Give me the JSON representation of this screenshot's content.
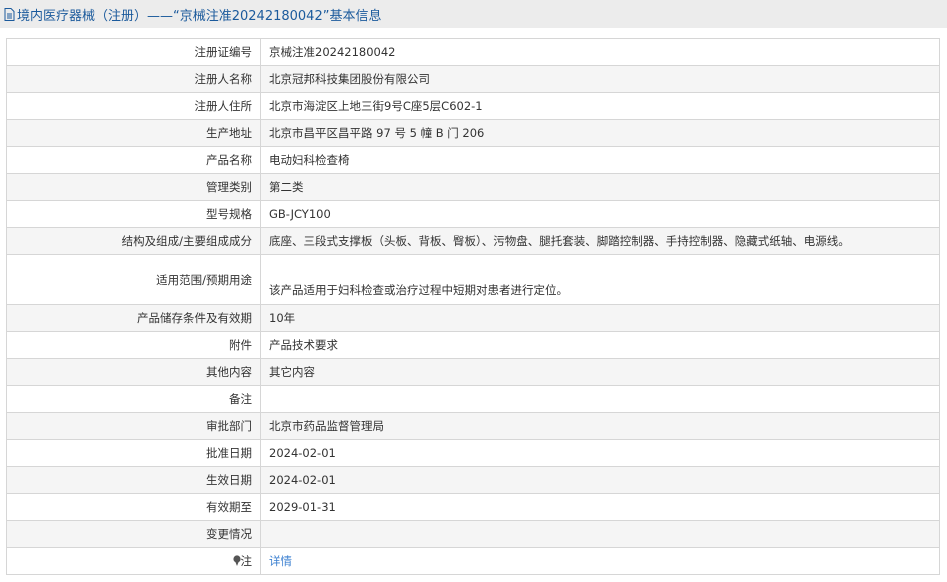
{
  "header": {
    "title": "境内医疗器械（注册）——“京械注准20242180042”基本信息"
  },
  "rows": [
    {
      "label": "注册证编号",
      "value": "京械注准20242180042"
    },
    {
      "label": "注册人名称",
      "value": "北京冠邦科技集团股份有限公司"
    },
    {
      "label": "注册人住所",
      "value": "北京市海淀区上地三街9号C座5层C602-1"
    },
    {
      "label": "生产地址",
      "value": "北京市昌平区昌平路 97 号 5 幢 B 门 206"
    },
    {
      "label": "产品名称",
      "value": "电动妇科检查椅"
    },
    {
      "label": "管理类别",
      "value": "第二类"
    },
    {
      "label": "型号规格",
      "value": "GB-JCY100"
    },
    {
      "label": "结构及组成/主要组成成分",
      "value": "底座、三段式支撑板（头板、背板、臀板）、污物盘、腿托套装、脚踏控制器、手持控制器、隐藏式纸轴、电源线。"
    },
    {
      "label": "适用范围/预期用途",
      "value": "该产品适用于妇科检查或治疗过程中短期对患者进行定位。"
    },
    {
      "label": "产品储存条件及有效期",
      "value": "10年"
    },
    {
      "label": "附件",
      "value": "产品技术要求"
    },
    {
      "label": "其他内容",
      "value": "其它内容"
    },
    {
      "label": "备注",
      "value": ""
    },
    {
      "label": "审批部门",
      "value": "北京市药品监督管理局"
    },
    {
      "label": "批准日期",
      "value": "2024-02-01"
    },
    {
      "label": "生效日期",
      "value": "2024-02-01"
    },
    {
      "label": "有效期至",
      "value": "2029-01-31"
    },
    {
      "label": "变更情况",
      "value": ""
    }
  ],
  "note": {
    "label": "注",
    "link": "详情"
  }
}
